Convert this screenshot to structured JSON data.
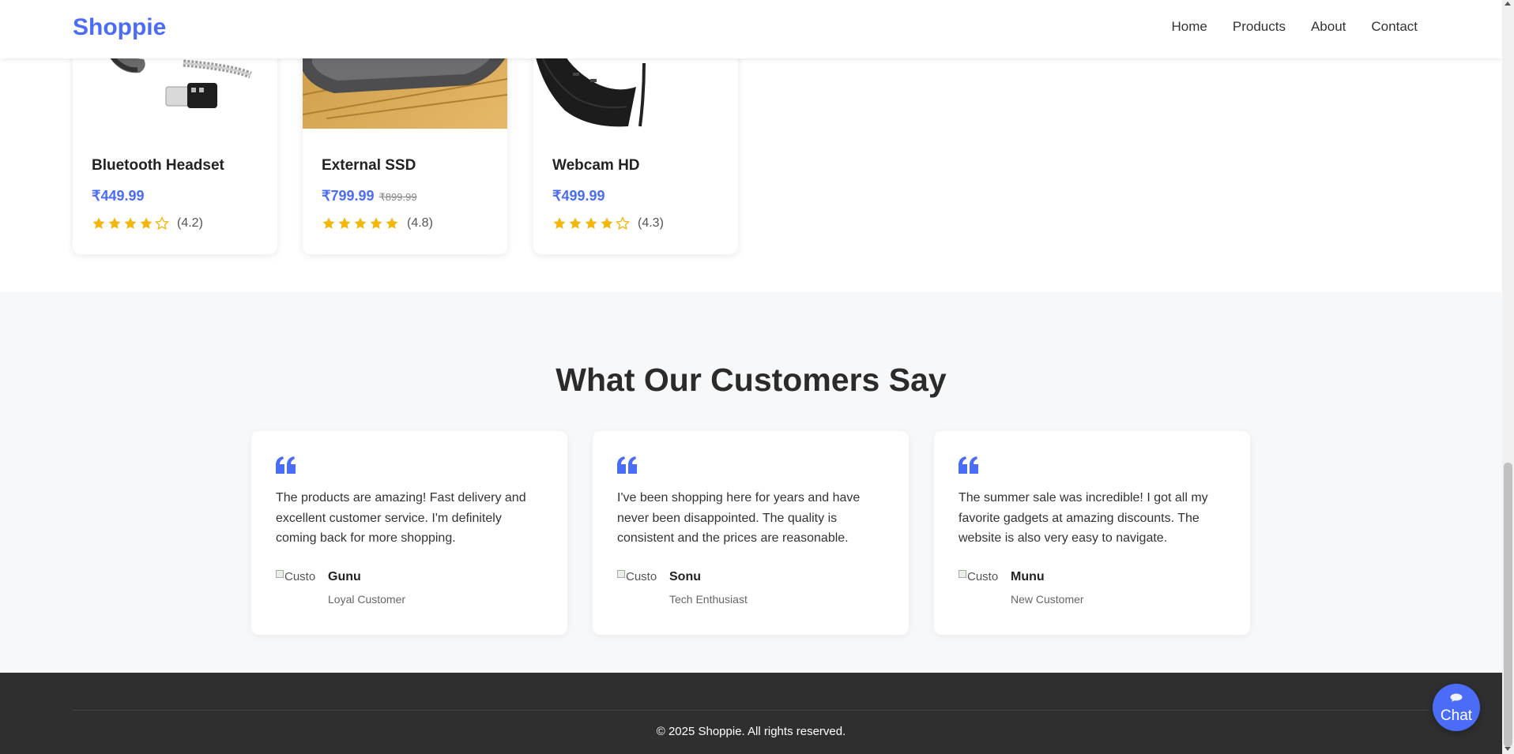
{
  "header": {
    "logo": "Shoppie",
    "nav": [
      "Home",
      "Products",
      "About",
      "Contact"
    ]
  },
  "products": [
    {
      "name": "Bluetooth Headset",
      "price": "₹449.99",
      "old_price": "",
      "rating_text": "(4.2)",
      "rating": 4.2
    },
    {
      "name": "External SSD",
      "price": "₹799.99",
      "old_price": "₹899.99",
      "rating_text": "(4.8)",
      "rating": 4.8
    },
    {
      "name": "Webcam HD",
      "price": "₹499.99",
      "old_price": "",
      "rating_text": "(4.3)",
      "rating": 4.3
    }
  ],
  "testimonials": {
    "title": "What Our Customers Say",
    "items": [
      {
        "text": "The products are amazing! Fast delivery and excellent customer service. I'm definitely coming back for more shopping.",
        "name": "Gunu",
        "role": "Loyal Customer",
        "avatar_alt": "Customer"
      },
      {
        "text": "I've been shopping here for years and have never been disappointed. The quality is consistent and the prices are reasonable.",
        "name": "Sonu",
        "role": "Tech Enthusiast",
        "avatar_alt": "Customer"
      },
      {
        "text": "The summer sale was incredible! I got all my favorite gadgets at amazing discounts. The website is also very easy to navigate.",
        "name": "Munu",
        "role": "New Customer",
        "avatar_alt": "Customer"
      }
    ]
  },
  "footer": {
    "copyright": "© 2025 Shoppie. All rights reserved."
  },
  "chat": {
    "label": "Chat"
  },
  "colors": {
    "accent": "#4a6cf7",
    "star": "#f5b50a",
    "footer_bg": "#2f2f2f",
    "section_bg": "#f7f8fa"
  },
  "icons": {
    "quote": "quote-icon",
    "star_full": "star-icon",
    "star_empty": "star-outline-icon",
    "chat": "chat-bubble-icon"
  }
}
